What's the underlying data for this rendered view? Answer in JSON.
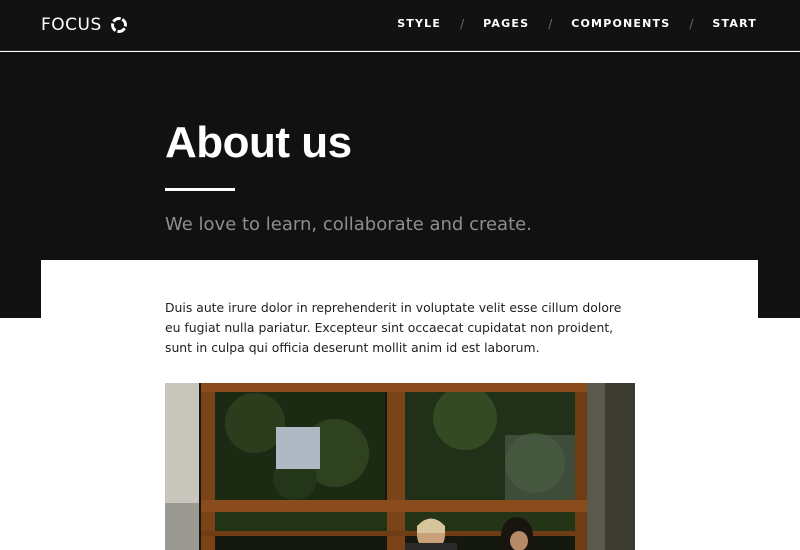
{
  "header": {
    "brand": "FOCUS",
    "brand_icon": "circle-notch-icon",
    "nav": [
      {
        "label": "STYLE"
      },
      {
        "label": "PAGES"
      },
      {
        "label": "COMPONENTS"
      },
      {
        "label": "START"
      }
    ],
    "separator": "/"
  },
  "hero": {
    "title": "About us",
    "subtitle": "We love to learn, collaborate and create."
  },
  "content": {
    "paragraph": "Duis aute irure dolor in reprehenderit in voluptate velit esse cillum dolore eu fugiat nulla pariatur. Excepteur sint occaecat cupidatat non proident, sunt in culpa qui officia deserunt mollit anim id est laborum.",
    "image": "photo-people-at-window"
  },
  "colors": {
    "header_bg": "#121212",
    "hero_bg": "#111111",
    "hero_subtitle": "#8e8e8e",
    "window_frame": "#7a4318"
  }
}
